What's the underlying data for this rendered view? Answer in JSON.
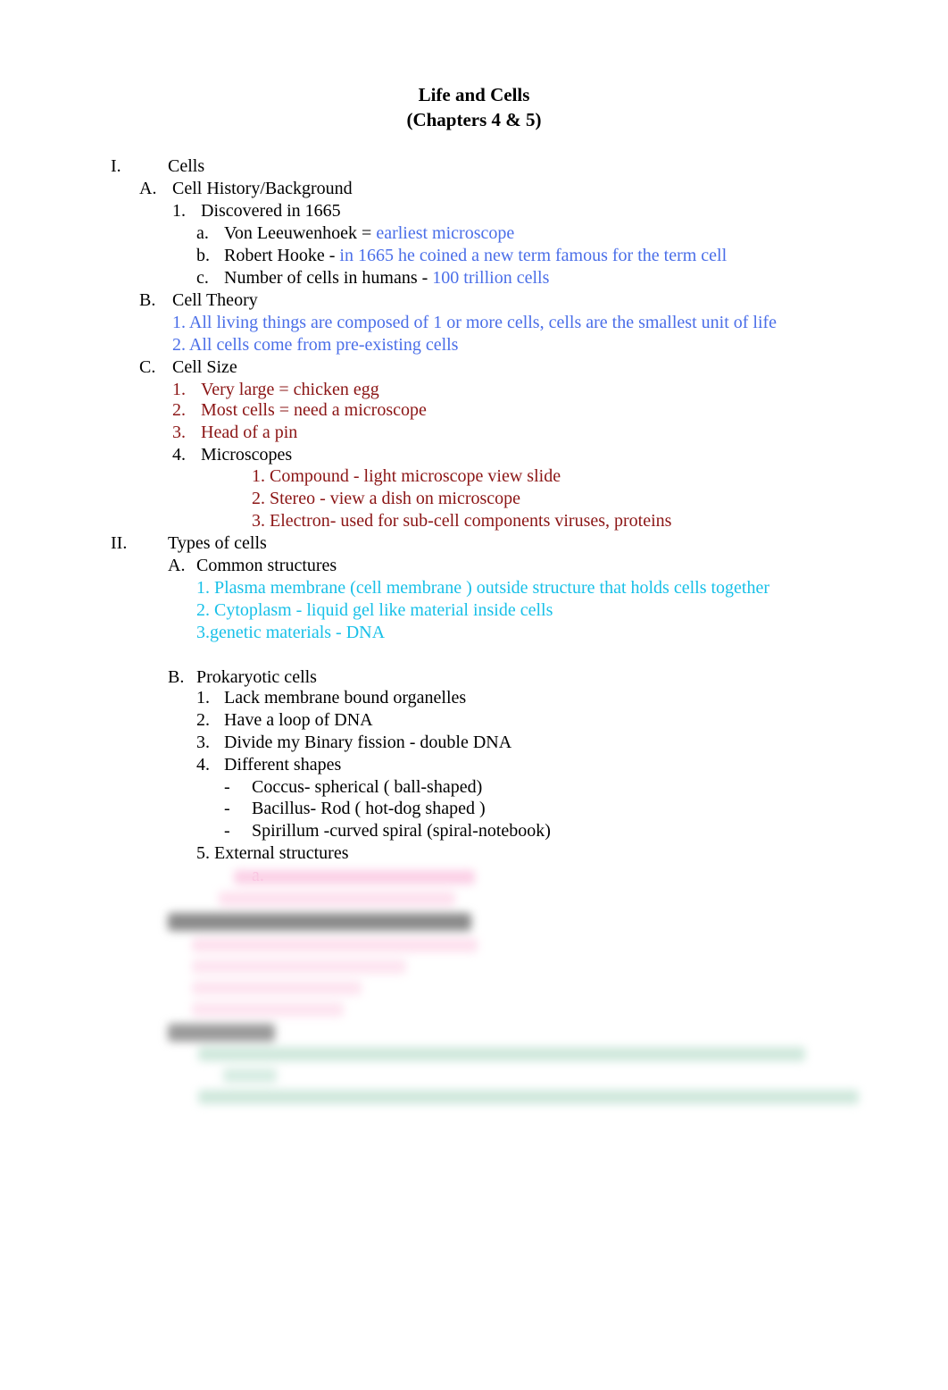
{
  "title": "Life and Cells",
  "subtitle": "(Chapters 4 & 5)",
  "colors": {
    "black": "#000000",
    "blue": "#4a6ee8",
    "dark_red": "#8b1515",
    "cyan": "#18c0e8",
    "pink": "#f090c8",
    "green_blur": "#cfe8dc"
  },
  "outline": {
    "s1": {
      "marker": "I.",
      "text": "Cells"
    },
    "s1a": {
      "marker": "A.",
      "text": "Cell History/Background"
    },
    "s1a1": {
      "marker": "1.",
      "text": "Discovered in 1665"
    },
    "s1a1a": {
      "marker": "a.",
      "text": "Von Leeuwenhoek = ",
      "answer": "earliest microscope"
    },
    "s1a1b": {
      "marker": "b.",
      "text": "Robert Hooke - ",
      "answer": "in 1665 he coined a new term famous for the term cell"
    },
    "s1a1c": {
      "marker": "c.",
      "text": "Number of cells in humans - ",
      "answer": "100 trillion cells"
    },
    "s1b": {
      "marker": "B.",
      "text": "Cell Theory"
    },
    "s1b1": {
      "text": "1. All living things are composed of 1 or more cells, cells are the smallest unit of life"
    },
    "s1b2": {
      "text": "2. All cells come from pre-existing cells"
    },
    "s1c": {
      "marker": "C.",
      "text": "Cell Size"
    },
    "s1c1": {
      "marker": "1.",
      "text": "Very large = chicken egg"
    },
    "s1c2": {
      "marker": "2.",
      "text": "Most cells = need a microscope"
    },
    "s1c3": {
      "marker": "3.",
      "text": "Head of a pin"
    },
    "s1c4": {
      "marker": "4.",
      "text": "Microscopes"
    },
    "s1c4_1": {
      "text": "1. Compound - light microscope view slide"
    },
    "s1c4_2": {
      "text": "2. Stereo - view a dish on microscope"
    },
    "s1c4_3": {
      "text": "3. Electron- used for sub-cell components viruses, proteins"
    },
    "s2": {
      "marker": "II.",
      "text": "Types of cells"
    },
    "s2a": {
      "marker": "A.",
      "text": "Common structures"
    },
    "s2a1": {
      "text": "1. Plasma membrane (cell membrane ) outside structure that holds cells together"
    },
    "s2a2": {
      "text": "2. Cytoplasm - liquid gel like material inside cells"
    },
    "s2a3": {
      "text": "3.genetic materials - DNA"
    },
    "s2b": {
      "marker": "B.",
      "text": "Prokaryotic cells"
    },
    "s2b1": {
      "marker": "1.",
      "text": "Lack membrane bound organelles"
    },
    "s2b2": {
      "marker": "2.",
      "text": "Have a loop of DNA"
    },
    "s2b3": {
      "marker": "3.",
      "text": "Divide my Binary fission - double DNA"
    },
    "s2b4": {
      "marker": "4.",
      "text": "Different shapes"
    },
    "s2b4_1": {
      "marker": "-",
      "text": "Coccus- spherical ( ball-shaped)"
    },
    "s2b4_2": {
      "marker": "-",
      "text": "Bacillus- Rod ( hot-dog shaped )"
    },
    "s2b4_3": {
      "marker": "-",
      "text": "Spirillum -curved spiral (spiral-notebook)"
    },
    "s2b5": {
      "text": "5. External structures"
    },
    "s2b5a": {
      "marker": "a."
    }
  }
}
